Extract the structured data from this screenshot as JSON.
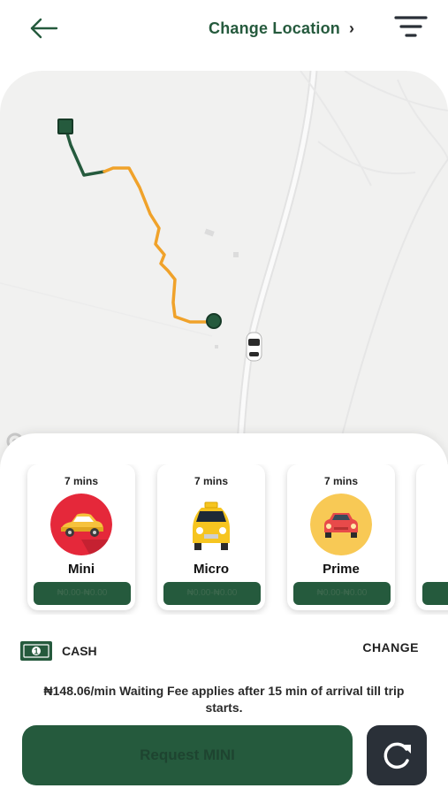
{
  "header": {
    "change_location_label": "Change Location",
    "chevron": "›"
  },
  "icons": {
    "back": "arrow-left-icon",
    "filter": "filter-icon",
    "refresh": "refresh-icon",
    "cash": "cash-note-icon"
  },
  "colors": {
    "brand_green": "#255a3d",
    "route_orange": "#f0a22a",
    "dark_button": "#2a3038"
  },
  "vehicles": [
    {
      "eta": "7 mins",
      "name": "Mini",
      "price": "₦0.00-₦0.00"
    },
    {
      "eta": "7 mins",
      "name": "Micro",
      "price": "₦0.00-₦0.00"
    },
    {
      "eta": "7 mins",
      "name": "Prime",
      "price": "₦0.00-₦0.00"
    }
  ],
  "payment": {
    "method_label": "CASH",
    "change_label": "CHANGE"
  },
  "fee_note": "₦148.06/min Waiting Fee applies after 15 min of arrival till trip starts.",
  "request_button_label": "Request MINI"
}
